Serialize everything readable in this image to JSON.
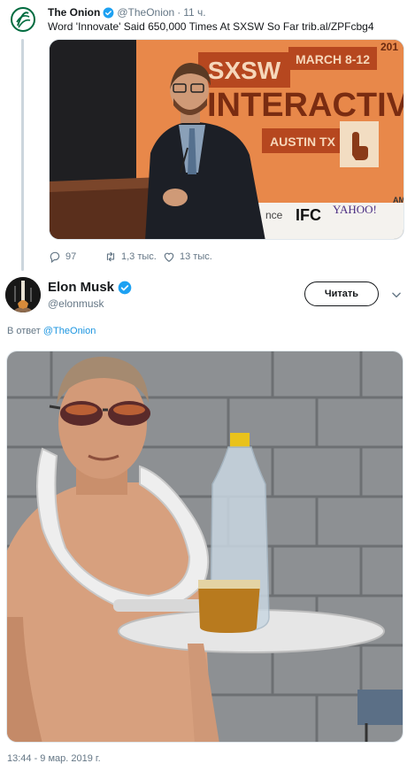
{
  "parent_tweet": {
    "author_name": "The Onion",
    "author_handle": "@TheOnion",
    "separator": "·",
    "time_ago": "11 ч.",
    "text": "Word 'Innovate' Said 650,000 Times At SXSW So Far trib.al/ZPFcbg4",
    "media": {
      "banner_lines": [
        "SXSW",
        "MARCH 8-12",
        "INTERACTIV",
        "AUSTIN TX"
      ],
      "year_fragment": "201",
      "sponsor_logos": [
        "nce",
        "IFC",
        "YAHOO!",
        "AM"
      ]
    },
    "actions": {
      "reply_count": "97",
      "retweet_count": "1,3 тыс.",
      "like_count": "13 тыс."
    },
    "icons": [
      "onion-logo-icon",
      "verified-badge-icon",
      "reply-icon",
      "retweet-icon",
      "like-icon"
    ]
  },
  "main_tweet": {
    "author_name": "Elon Musk",
    "author_handle": "@elonmusk",
    "follow_label": "Читать",
    "reply_prefix": "В ответ",
    "reply_target": "@TheOnion",
    "timestamp": "13:44 - 9 мар. 2019 г.",
    "icons": [
      "verified-badge-icon",
      "chevron-down-icon"
    ]
  },
  "colors": {
    "text_primary": "#14171a",
    "text_secondary": "#657786",
    "link": "#1b95e0",
    "verified": "#1da1f2",
    "divider": "#ccd6dd",
    "onion_green": "#006b3f",
    "banner_orange": "#e8884a"
  }
}
